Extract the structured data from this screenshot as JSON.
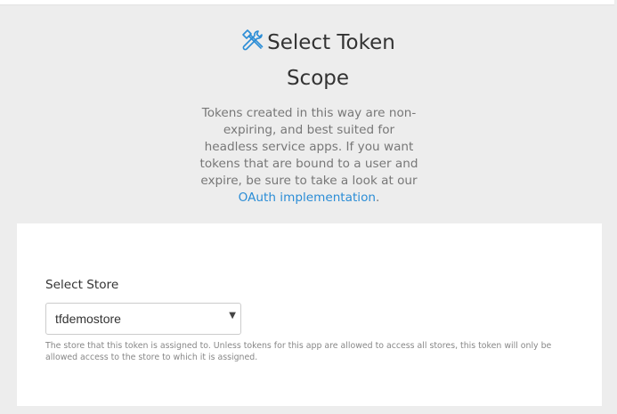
{
  "header": {
    "icon": "tools-icon",
    "title": "Select Token Scope"
  },
  "description": {
    "text": "Tokens created in this way are non-expiring, and best suited for headless service apps. If you want tokens that are bound to a user and expire, be sure to take a look at our ",
    "link_label": "OAuth implementation",
    "suffix": "."
  },
  "store_field": {
    "label": "Select Store",
    "selected_value": "tfdemostore",
    "caret_icon": "caret-down-icon",
    "help_text": "The store that this token is assigned to. Unless tokens for this app are allowed to access all stores, this token will only be allowed access to the store to which it is assigned."
  },
  "colors": {
    "background": "#ededed",
    "card": "#ffffff",
    "link": "#2b8dd6",
    "icon": "#2b8dd6"
  }
}
